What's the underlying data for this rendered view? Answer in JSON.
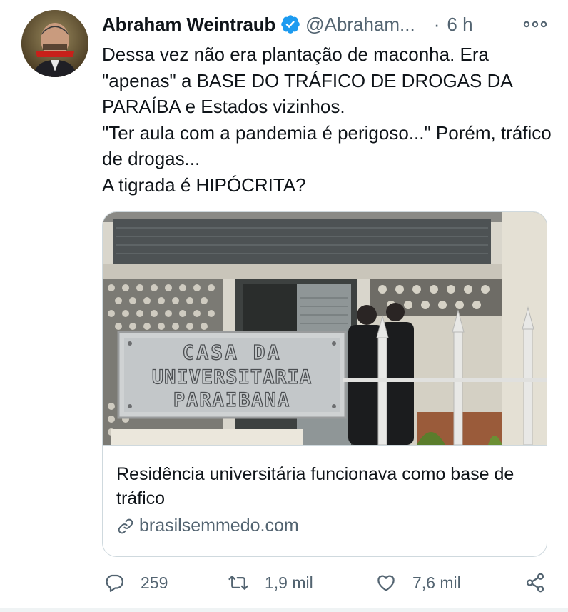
{
  "author": {
    "name": "Abraham Weintraub",
    "handle": "@Abraham...",
    "separator": "·",
    "time": "6 h"
  },
  "tweet": {
    "text": "Dessa vez não era plantação de maconha. Era \"apenas\" a BASE DO TRÁFICO DE DROGAS DA PARAÍBA e Estados vizinhos.\n\"Ter aula com a pandemia é perigoso...\" Porém, tráfico de drogas...\nA tigrada é HIPÓCRITA?"
  },
  "card": {
    "title": "Residência universitária funcionava como base de tráfico",
    "domain": "brasilsemmedo.com",
    "sign_lines": [
      "CASA DA",
      "UNIVERSITARIA",
      "PARAIBANA"
    ]
  },
  "actions": {
    "replies": "259",
    "retweets": "1,9 mil",
    "likes": "7,6 mil"
  },
  "colors": {
    "verified": "#1d9bf0",
    "secondary_text": "#536471",
    "border": "#cfd9de"
  },
  "icons": [
    "verified-icon",
    "more-icon",
    "link-icon",
    "reply-icon",
    "retweet-icon",
    "like-icon",
    "share-icon"
  ]
}
